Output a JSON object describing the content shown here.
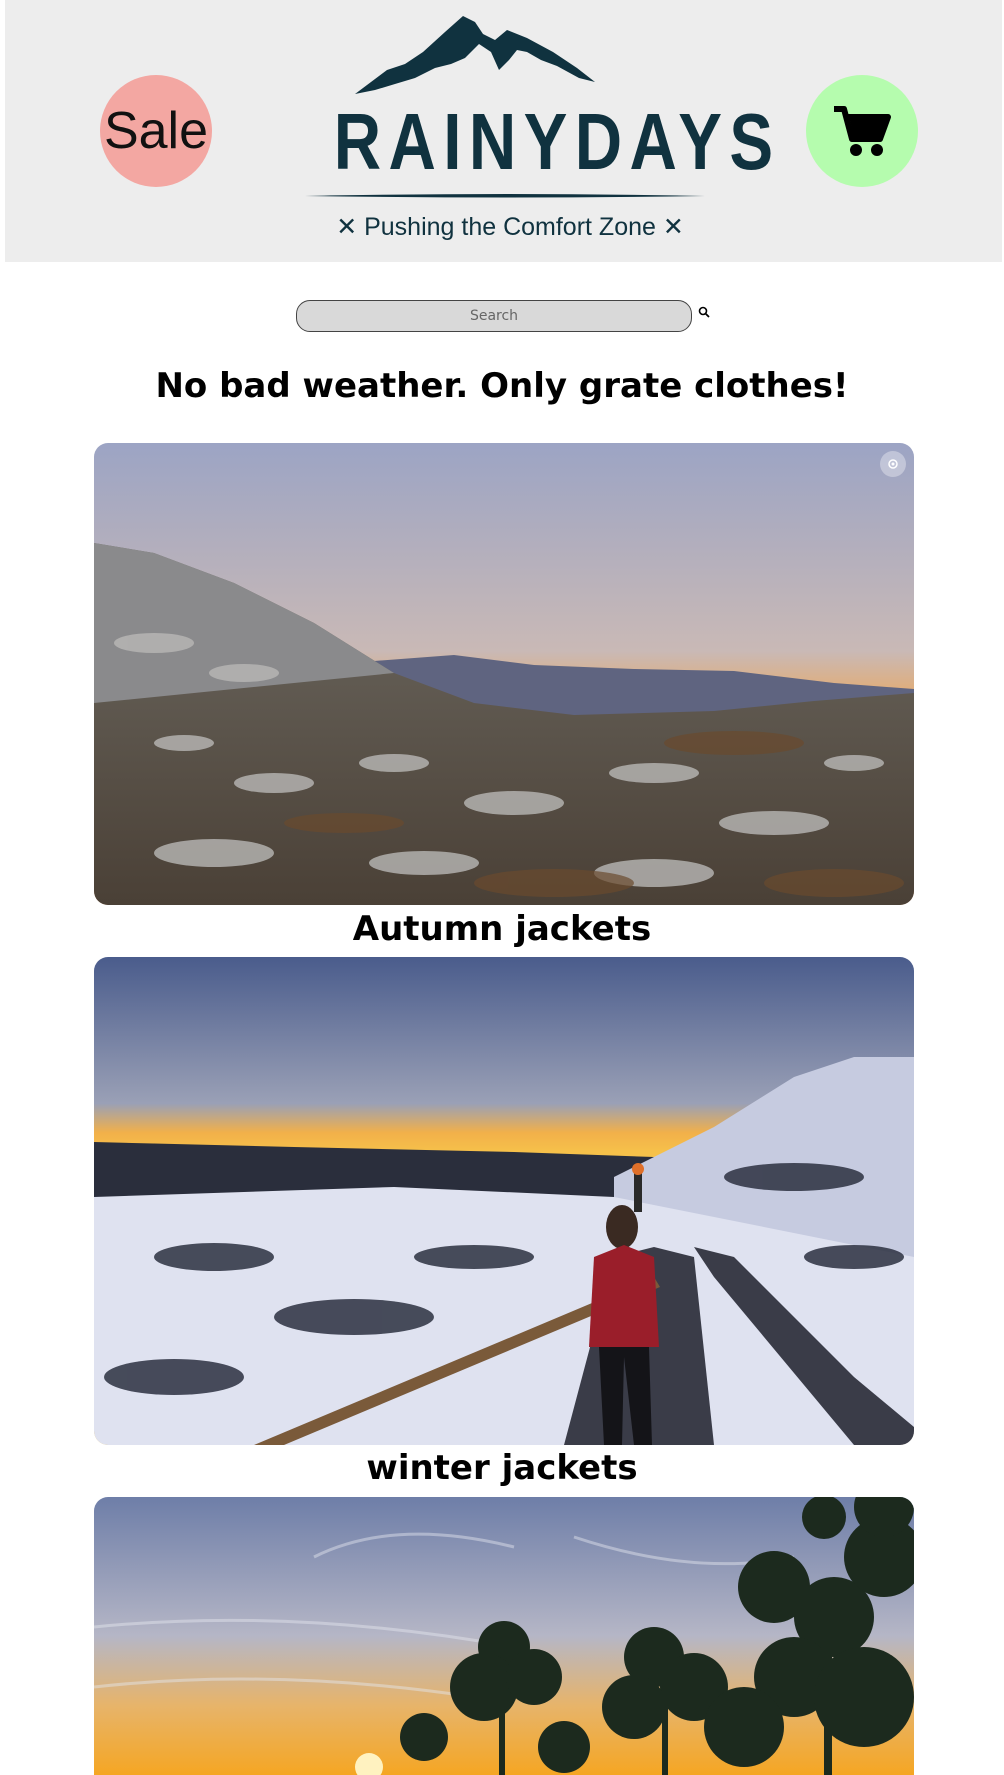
{
  "header": {
    "sale_label": "Sale",
    "logo_text": "RAINYDAYS",
    "tagline": "✕ Pushing the Comfort Zone ✕",
    "cart_icon": "cart-icon",
    "colors": {
      "header_bg": "#ededed",
      "sale_bg": "#f3a7a2",
      "cart_bg": "#b5fcae",
      "logo": "#10323f"
    }
  },
  "search": {
    "placeholder": "Search",
    "icon": "search-icon"
  },
  "main": {
    "headline": "No bad weather. Only grate clothes!",
    "categories": [
      {
        "title": "Autumn jackets",
        "image": "autumn mountain sunset landscape"
      },
      {
        "title": "winter jackets",
        "image": "snowy path sunset with hiker in red jacket"
      },
      {
        "title": "",
        "image": "trees silhouetted against sunset sky"
      }
    ]
  }
}
